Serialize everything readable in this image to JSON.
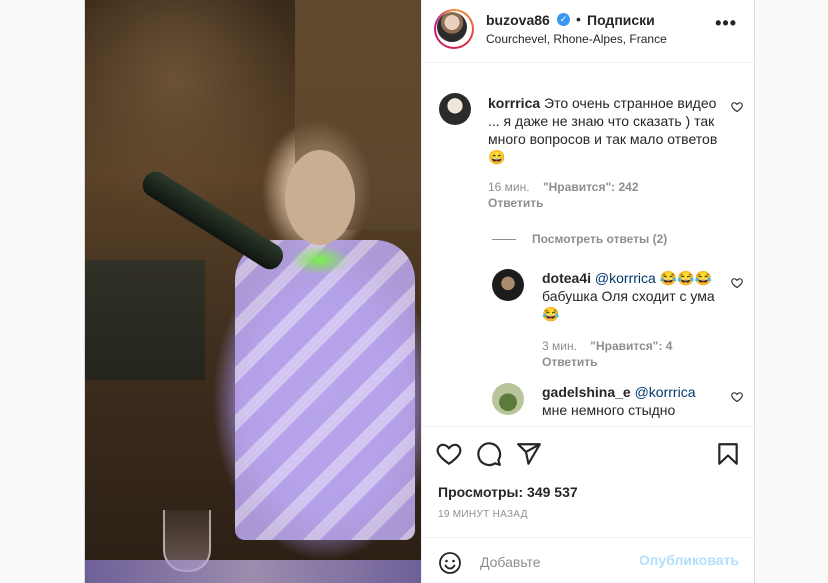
{
  "post": {
    "username": "buzova86",
    "separator": "•",
    "follow_label": "Подписки",
    "location": "Courchevel, Rhone-Alpes, France",
    "more_label": "•••"
  },
  "comments": [
    {
      "username": "korrrica",
      "text": "Это очень странное видео ... я даже не знаю что сказать ) так много вопросов и так мало ответов 😄",
      "time": "16 мин.",
      "likes": "\"Нравится\": 242",
      "reply_label": "Ответить",
      "view_replies": "Посмотреть ответы (2)"
    },
    {
      "username": "dotea4i",
      "mention": "@korrrica",
      "text": " 😂😂😂бабушка Оля сходит с ума 😂",
      "time": "3 мин.",
      "likes": "\"Нравится\": 4",
      "reply_label": "Ответить"
    },
    {
      "username": "gadelshina_e",
      "mention": "@korrrica",
      "text": " мне немного стыдно"
    }
  ],
  "stats": {
    "views": "Просмотры: 349 537",
    "posted": "19 МИНУТ НАЗАД"
  },
  "composer": {
    "placeholder": "Добавьте",
    "publish_label": "Опубликовать"
  },
  "icons": {
    "like": "heart-icon",
    "comment": "comment-icon",
    "share": "share-icon",
    "save": "bookmark-icon",
    "emoji": "emoji-icon",
    "verified": "verified-badge-icon"
  },
  "colors": {
    "link": "#00376b",
    "verified": "#3897f0",
    "publish_disabled": "#b2dffc",
    "muted": "#8e8e8e"
  }
}
